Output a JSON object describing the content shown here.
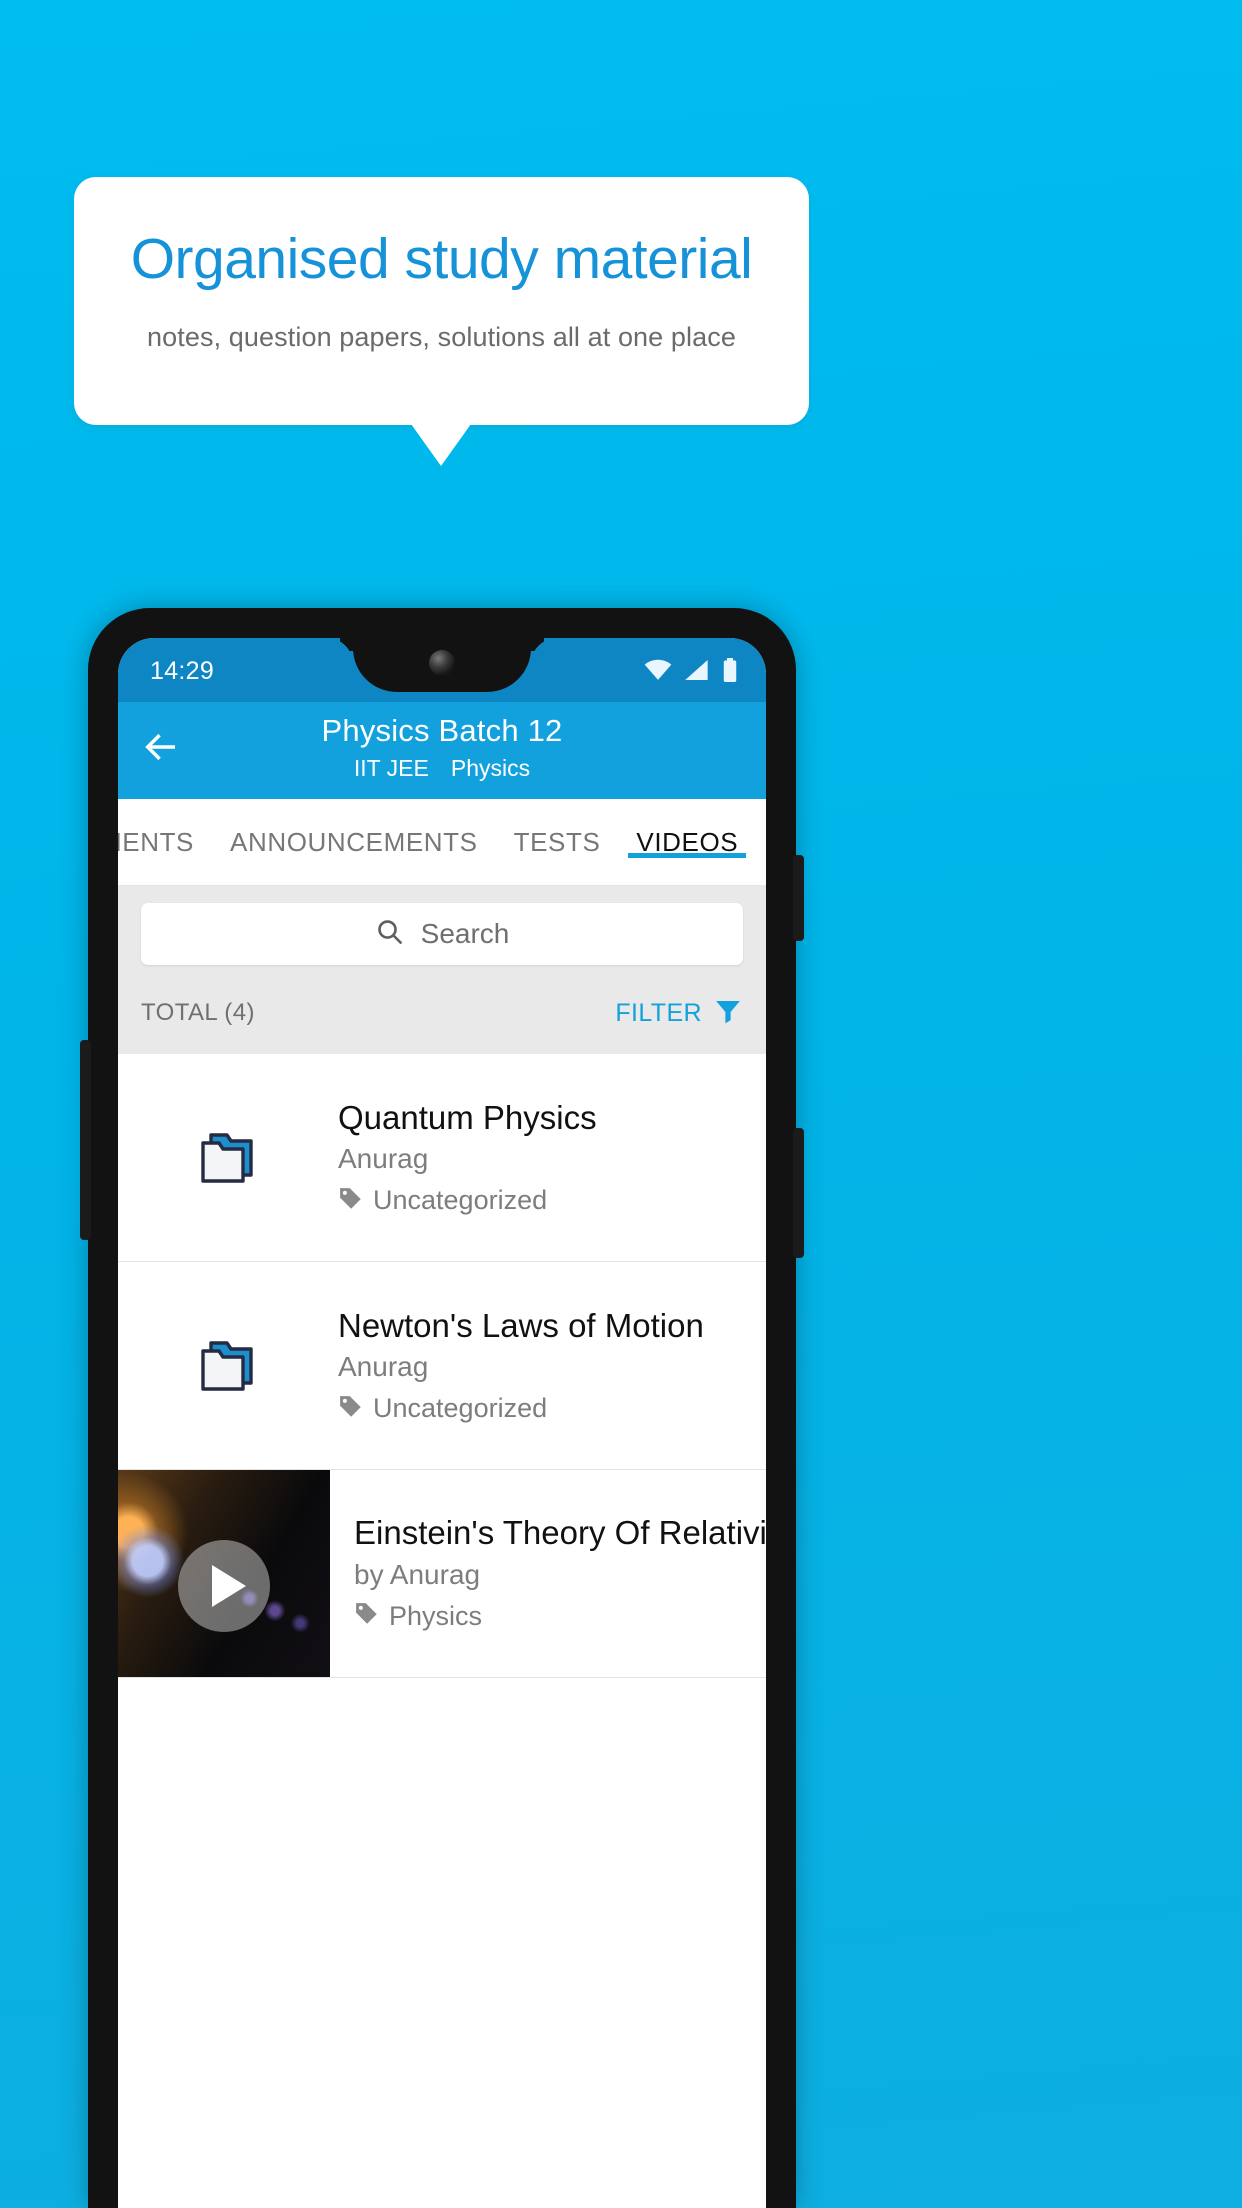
{
  "theme": {
    "background": "#00b4e8",
    "accent": "#13a1de",
    "title_blue": "#1592d8",
    "statusbar_blue": "#0e86c4"
  },
  "promo": {
    "title": "Organised study material",
    "subtitle": "notes, question papers, solutions all at one place"
  },
  "phone": {
    "statusbar": {
      "time": "14:29",
      "icons": [
        "wifi-icon",
        "signal-icon",
        "battery-icon"
      ]
    },
    "appbar": {
      "back_icon": "back-arrow-icon",
      "title": "Physics Batch 12",
      "subtitle_exam": "IIT JEE",
      "subtitle_subject": "Physics"
    },
    "tabs": [
      {
        "label": "MENTS",
        "active": false
      },
      {
        "label": "ANNOUNCEMENTS",
        "active": false
      },
      {
        "label": "TESTS",
        "active": false
      },
      {
        "label": "VIDEOS",
        "active": true
      }
    ],
    "search": {
      "icon": "search-icon",
      "placeholder": "Search",
      "value": ""
    },
    "listheader": {
      "total_label": "TOTAL (4)",
      "filter_label": "FILTER",
      "filter_icon": "filter-icon"
    },
    "items": [
      {
        "type": "folder",
        "icon": "folder-icon",
        "title": "Quantum Physics",
        "author": "Anurag",
        "tag_icon": "tag-icon",
        "tag": "Uncategorized"
      },
      {
        "type": "folder",
        "icon": "folder-icon",
        "title": "Newton's Laws of Motion",
        "author": "Anurag",
        "tag_icon": "tag-icon",
        "tag": "Uncategorized"
      },
      {
        "type": "video",
        "icon": "play-icon",
        "title": "Einstein's Theory Of Relativity",
        "author": "by Anurag",
        "tag_icon": "tag-icon",
        "tag": "Physics"
      }
    ]
  }
}
